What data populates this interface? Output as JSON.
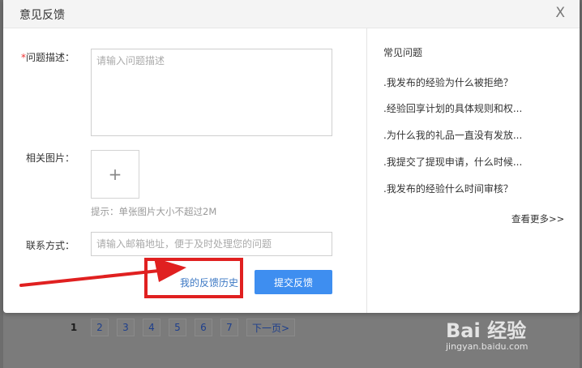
{
  "dialog": {
    "title": "意见反馈",
    "close_label": "X"
  },
  "form": {
    "description": {
      "required_mark": "*",
      "label": "问题描述：",
      "placeholder": "请输入问题描述",
      "value": ""
    },
    "image": {
      "label": "相关图片：",
      "add_symbol": "+",
      "hint": "提示：单张图片大小不超过2M"
    },
    "contact": {
      "label": "联系方式：",
      "placeholder": "请输入邮箱地址，便于及时处理您的问题",
      "value": ""
    },
    "history_link": "我的反馈历史",
    "submit_label": "提交反馈"
  },
  "faq": {
    "title": "常见问题",
    "items": [
      ".我发布的经验为什么被拒绝？",
      ".经验回享计划的具体规则和权...",
      ".为什么我的礼品一直没有发放...",
      ".我提交了提现申请，什么时候...",
      ".我发布的经验什么时间审核？"
    ],
    "more": "查看更多>>"
  },
  "pagination": {
    "current": "1",
    "pages": [
      "2",
      "3",
      "4",
      "5",
      "6",
      "7"
    ],
    "next": "下一页>"
  },
  "watermark": {
    "main": "Bai 经验",
    "sub": "jingyan.baidu.com"
  },
  "annotation": {
    "highlight_color": "#e02020"
  }
}
